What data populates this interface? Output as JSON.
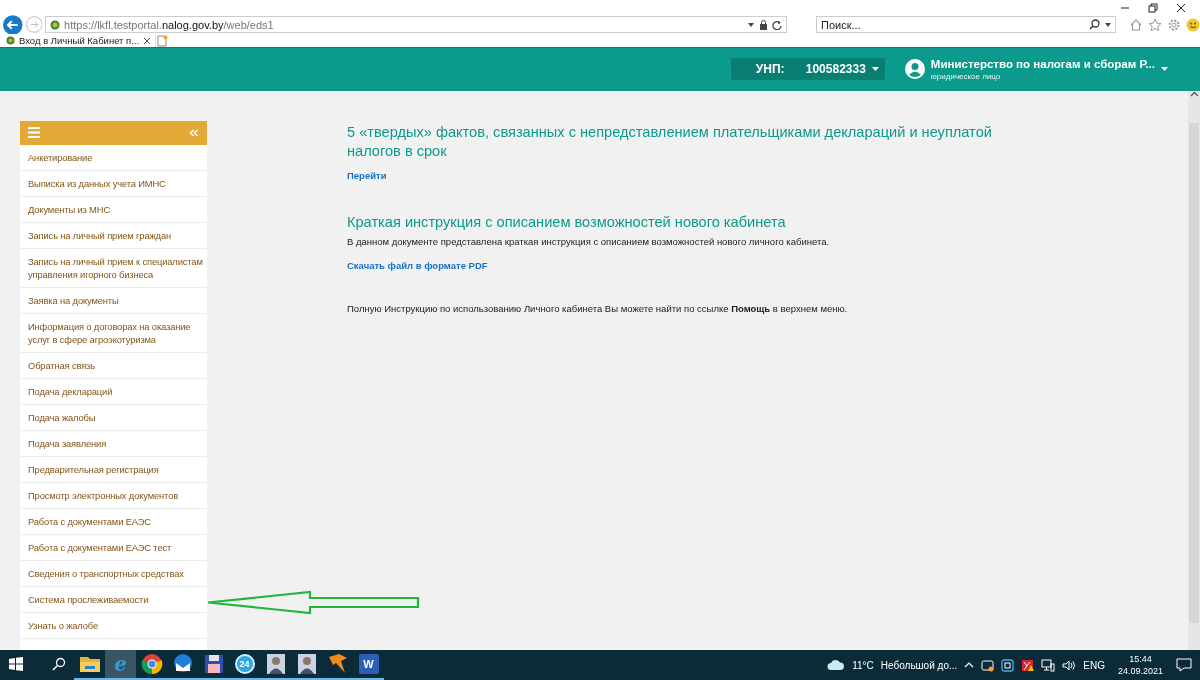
{
  "browser": {
    "url": "https://lkfl.testportal.**nalog.gov.by**/web/eds1",
    "search_placeholder": "Поиск...",
    "tabs": [
      {
        "title": "Вход в Личный Кабинет п...",
        "selected": true
      }
    ]
  },
  "header": {
    "unp_label": "УНП:",
    "unp_value": "100582333",
    "user_name": "Министерство по налогам и сборам Р...",
    "user_role": "юридическое лицо"
  },
  "sidebar": {
    "items": [
      {
        "label": "Анкетирование"
      },
      {
        "label": "Выписка из данных учета ИМНС"
      },
      {
        "label": "Документы из МНС"
      },
      {
        "label": "Запись на личный прием граждан"
      },
      {
        "label": "Запись на личный прием к специалистам управления игорного бизнеса"
      },
      {
        "label": "Заявка на документы"
      },
      {
        "label": "Информация о договорах на оказание услуг в сфере агроэкотуризма"
      },
      {
        "label": "Обратная связь"
      },
      {
        "label": "Подача деклараций"
      },
      {
        "label": "Подача жалобы"
      },
      {
        "label": "Подача заявления"
      },
      {
        "label": "Предварительная регистрация"
      },
      {
        "label": "Просмотр электронных документов"
      },
      {
        "label": "Работа с документами ЕАЭС"
      },
      {
        "label": "Работа с документами ЕАЭС тест"
      },
      {
        "label": "Сведения о транспортных средствах"
      },
      {
        "label": "Система прослеживаемости"
      },
      {
        "label": "Узнать о жалобе"
      }
    ]
  },
  "content": {
    "sections": [
      {
        "title": "5 «твердых» фактов, связанных с непредставлением плательщиками деклараций и неуплатой налогов в срок",
        "link": "Перейти"
      },
      {
        "title": "Краткая инструкция с описанием возможностей нового кабинета",
        "text": "В данном документе представлена краткая инструкция с описанием возможностей нового личного кабинета.",
        "link": "Скачать файл в формате PDF"
      }
    ],
    "note": "Полную Инструкцию по использованию Личного кабинета Вы можете найти по ссылке **Помощь** в верхнем меню."
  },
  "taskbar": {
    "apps": [
      {
        "kind": "folder",
        "active": false
      },
      {
        "kind": "ie",
        "label": "e",
        "active": true
      },
      {
        "kind": "chrome",
        "active": false
      },
      {
        "kind": "mail",
        "active": false
      },
      {
        "kind": "floppy",
        "active": false
      },
      {
        "kind": "badge",
        "label": "24",
        "active": false
      },
      {
        "kind": "portrait",
        "active": false
      },
      {
        "kind": "portrait",
        "active": false
      },
      {
        "kind": "fox",
        "active": false
      },
      {
        "kind": "word",
        "label": "W",
        "active": false
      }
    ],
    "weather_temp": "11°C",
    "weather_text": "Небольшой до...",
    "language": "ENG",
    "time": "15:44",
    "date": "24.09.2021"
  }
}
